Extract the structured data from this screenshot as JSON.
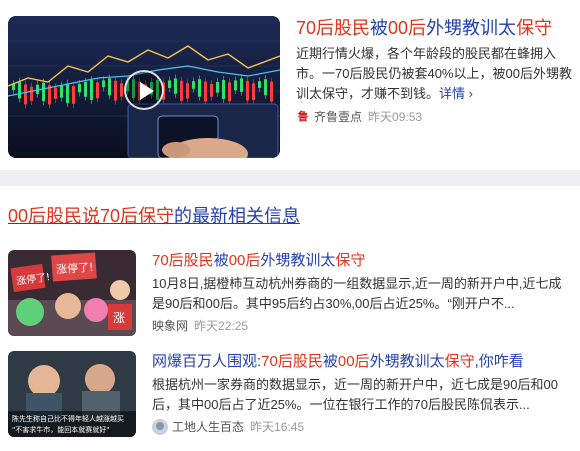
{
  "top_result": {
    "title_parts": [
      "70后股民",
      "被",
      "00后",
      "外甥教训太",
      "保守"
    ],
    "abstract": "近期行情火爆，各个年龄段的股民都在蜂拥入市。一70后股民仍被套40%以上，被00后外甥教训太保守，才赚不到钱。",
    "more_label": "详情 ›",
    "source": "齐鲁壹点",
    "source_logo_text": "鲁",
    "time": "昨天09:53"
  },
  "related": {
    "header_parts": [
      "00后股民说70后保守",
      "的最新相关信息"
    ],
    "items": [
      {
        "title_parts": [
          "70后股民",
          "被",
          "00后",
          "外甥教训太",
          "保守"
        ],
        "abstract": "10月8日,据橙柿互动杭州券商的一组数据显示,近一周的新开户中,近七成是90后和00后。其中95后约占30%,00后占近25%。“刚开户不...",
        "source": "映象网",
        "time": "昨天22:25",
        "thumb_signs": [
          "涨停了!",
          "涨停了!",
          "涨"
        ]
      },
      {
        "title_parts": [
          "网爆百万人围观:",
          "70后股民",
          "被",
          "00后",
          "外甥教训太",
          "保守",
          ",你咋看"
        ],
        "abstract": "根据杭州一家券商的数据显示，近一周的新开户中，近七成是90后和00后，其中00后占了近25%。一位在银行工作的70后股民陈侃表示...",
        "source": "工地人生百态",
        "time": "昨天16:45",
        "thumb_caption": [
          "陈先生称自己比不得年轻人越涨越买",
          "\"不害求牛市，能回本就赛就好\""
        ]
      }
    ]
  },
  "colors": {
    "link": "#2440b3",
    "highlight": "#e0331a",
    "meta": "#999999"
  },
  "icons": [
    "play-icon",
    "source-logo-icon",
    "avatar-icon"
  ]
}
